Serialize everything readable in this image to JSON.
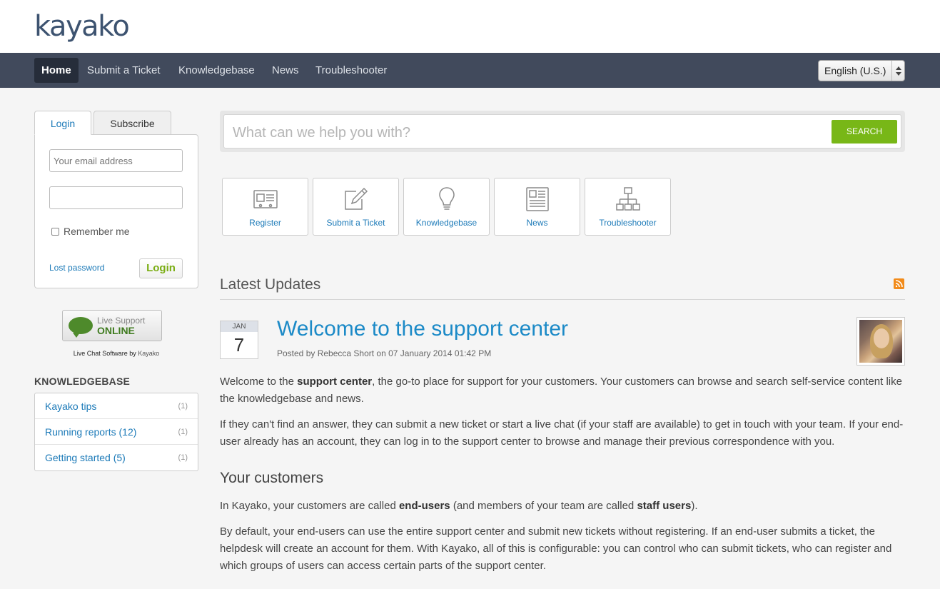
{
  "brand": {
    "logo": "kayako"
  },
  "nav": {
    "items": [
      "Home",
      "Submit a Ticket",
      "Knowledgebase",
      "News",
      "Troubleshooter"
    ],
    "language": "English (U.S.)"
  },
  "sidebar": {
    "tabs": {
      "login": "Login",
      "subscribe": "Subscribe"
    },
    "email_placeholder": "Your email address",
    "remember_me": "Remember me",
    "lost_password": "Lost password",
    "login_button": "Login",
    "live_support": {
      "line1": "Live Support",
      "line2": "ONLINE",
      "credit_prefix": "Live Chat Software by ",
      "credit_brand": "Kayako"
    },
    "knowledgebase": {
      "heading": "KNOWLEDGEBASE",
      "items": [
        {
          "name": "Kayako tips",
          "count": "(1)"
        },
        {
          "name": "Running reports (12)",
          "count": "(1)"
        },
        {
          "name": "Getting started (5)",
          "count": "(1)"
        }
      ]
    }
  },
  "search": {
    "placeholder": "What can we help you with?",
    "button": "SEARCH"
  },
  "tiles": [
    {
      "label": "Register",
      "icon": "register-card-icon"
    },
    {
      "label": "Submit a Ticket",
      "icon": "edit-pencil-icon"
    },
    {
      "label": "Knowledgebase",
      "icon": "lightbulb-icon"
    },
    {
      "label": "News",
      "icon": "newspaper-icon"
    },
    {
      "label": "Troubleshooter",
      "icon": "sitemap-icon"
    }
  ],
  "updates": {
    "title": "Latest Updates",
    "post": {
      "month": "JAN",
      "day": "7",
      "title": "Welcome to the support center",
      "meta": "Posted by Rebecca Short on 07 January 2014 01:42 PM",
      "p1": {
        "a": "Welcome to the ",
        "b": "support center",
        "c": ", the go-to place for support for your customers. Your customers can browse and search self-service content like the knowledgebase and news."
      },
      "p2": "If they can't find an answer, they can submit a new ticket or start a live chat (if your staff are available) to get in touch with your team. If your end-user already has an account, they can log in to the support center to browse and manage their previous correspondence with you.",
      "subheading": "Your customers",
      "p3": {
        "a": "In Kayako, your customers are called ",
        "b": "end-users",
        "c": " (and members of your team are called ",
        "d": "staff users",
        "e": ")."
      },
      "p4": "By default, your end-users can use the entire support center and submit new tickets without registering. If an end-user submits a ticket, the helpdesk will create an account for them. With Kayako, all of this is configurable: you can control who can submit tickets, who can register and which groups of users can access certain parts of the support center."
    }
  }
}
